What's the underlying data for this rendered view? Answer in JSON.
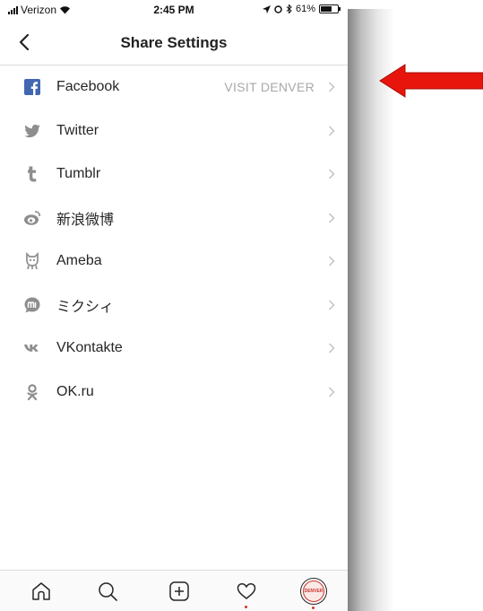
{
  "status_bar": {
    "carrier": "Verizon",
    "time": "2:45 PM",
    "battery": "61%"
  },
  "header": {
    "title": "Share Settings"
  },
  "items": [
    {
      "label": "Facebook",
      "value": "VISIT DENVER",
      "icon": "facebook-icon"
    },
    {
      "label": "Twitter",
      "value": "",
      "icon": "twitter-icon"
    },
    {
      "label": "Tumblr",
      "value": "",
      "icon": "tumblr-icon"
    },
    {
      "label": "新浪微博",
      "value": "",
      "icon": "weibo-icon"
    },
    {
      "label": "Ameba",
      "value": "",
      "icon": "ameba-icon"
    },
    {
      "label": "ミクシィ",
      "value": "",
      "icon": "mixi-icon"
    },
    {
      "label": "VKontakte",
      "value": "",
      "icon": "vkontakte-icon"
    },
    {
      "label": "OK.ru",
      "value": "",
      "icon": "ok-ru-icon"
    }
  ],
  "tab_bar": {
    "tabs": [
      "home-icon",
      "search-icon",
      "add-post-icon",
      "activity-heart-icon",
      "profile-avatar"
    ],
    "avatar_text": "DENVER"
  },
  "colors": {
    "facebook": "#3b5998",
    "icon_gray": "#8e8e8e",
    "arrow_red": "#e8150c",
    "notification_dot": "#d9302b"
  }
}
